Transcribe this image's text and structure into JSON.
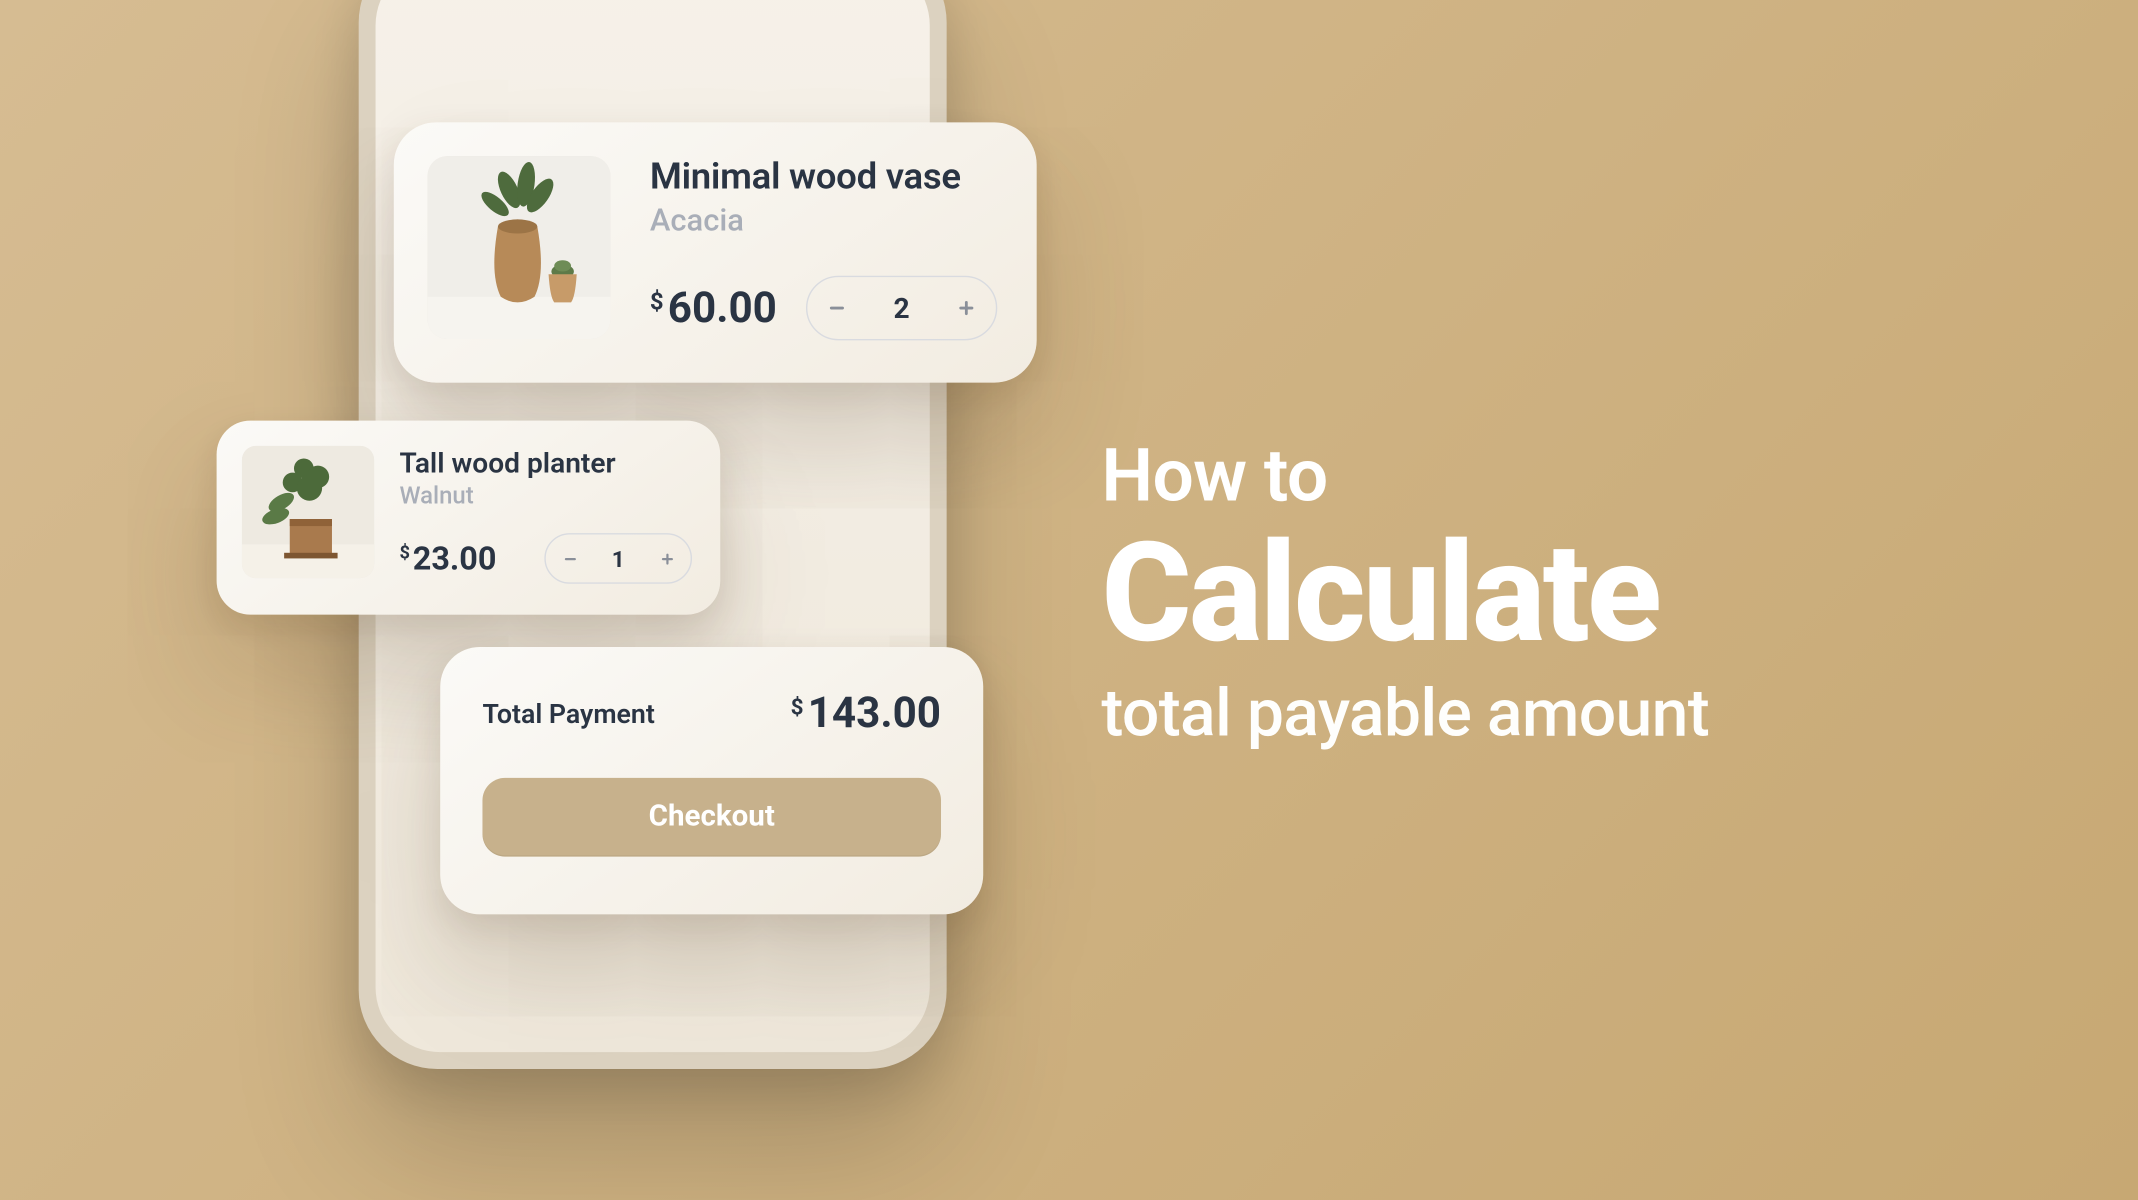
{
  "headline": {
    "line1": "How to",
    "line2": "Calculate",
    "line3": "total payable amount"
  },
  "cart": {
    "items": [
      {
        "name": "Minimal wood vase",
        "variant": "Acacia",
        "currency": "$",
        "price": "60.00",
        "qty": "2"
      },
      {
        "name": "Tall wood planter",
        "variant": "Walnut",
        "currency": "$",
        "price": "23.00",
        "qty": "1"
      }
    ],
    "total": {
      "label": "Total Payment",
      "currency": "$",
      "amount": "143.00"
    },
    "checkout_label": "Checkout"
  }
}
